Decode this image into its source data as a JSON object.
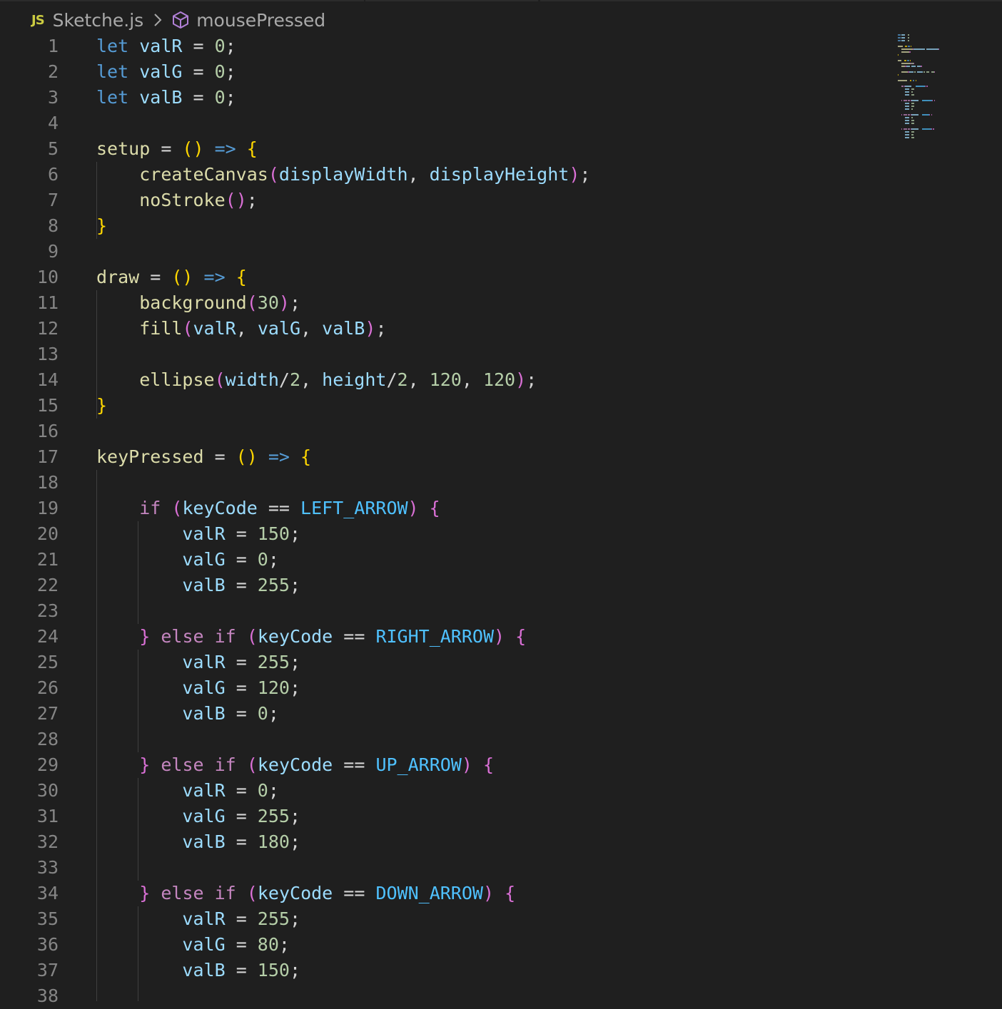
{
  "breadcrumb": {
    "file_badge": "JS",
    "file_name": "Sketche.js",
    "symbol_icon": "cube-icon",
    "symbol_name": "mousePressed"
  },
  "colors": {
    "background": "#1f1f1f",
    "keyword": "#569cd6",
    "control": "#c586c0",
    "variable": "#9cdcfe",
    "function": "#dcdcaa",
    "number": "#b5cea8",
    "constant": "#4fc1ff",
    "bracket_1": "#ffd700",
    "bracket_2": "#da70d6",
    "line_number": "#858585"
  },
  "lines": [
    {
      "n": "1",
      "tokens": [
        [
          "kw",
          "let"
        ],
        [
          "op",
          " "
        ],
        [
          "var",
          "valR"
        ],
        [
          "op",
          " = "
        ],
        [
          "num",
          "0"
        ],
        [
          "op",
          ";"
        ]
      ]
    },
    {
      "n": "2",
      "tokens": [
        [
          "kw",
          "let"
        ],
        [
          "op",
          " "
        ],
        [
          "var",
          "valG"
        ],
        [
          "op",
          " = "
        ],
        [
          "num",
          "0"
        ],
        [
          "op",
          ";"
        ]
      ]
    },
    {
      "n": "3",
      "tokens": [
        [
          "kw",
          "let"
        ],
        [
          "op",
          " "
        ],
        [
          "var",
          "valB"
        ],
        [
          "op",
          " = "
        ],
        [
          "num",
          "0"
        ],
        [
          "op",
          ";"
        ]
      ]
    },
    {
      "n": "4",
      "tokens": []
    },
    {
      "n": "5",
      "tokens": [
        [
          "fn",
          "setup"
        ],
        [
          "op",
          " = "
        ],
        [
          "p1",
          "()"
        ],
        [
          "op",
          " "
        ],
        [
          "kw",
          "=>"
        ],
        [
          "op",
          " "
        ],
        [
          "p1",
          "{"
        ]
      ]
    },
    {
      "n": "6",
      "tokens": [
        [
          "op",
          "    "
        ],
        [
          "fn",
          "createCanvas"
        ],
        [
          "p2",
          "("
        ],
        [
          "var",
          "displayWidth"
        ],
        [
          "op",
          ", "
        ],
        [
          "var",
          "displayHeight"
        ],
        [
          "p2",
          ")"
        ],
        [
          "op",
          ";"
        ]
      ]
    },
    {
      "n": "7",
      "tokens": [
        [
          "op",
          "    "
        ],
        [
          "fn",
          "noStroke"
        ],
        [
          "p2",
          "()"
        ],
        [
          "op",
          ";"
        ]
      ]
    },
    {
      "n": "8",
      "tokens": [
        [
          "p1",
          "}"
        ]
      ]
    },
    {
      "n": "9",
      "tokens": []
    },
    {
      "n": "10",
      "tokens": [
        [
          "fn",
          "draw"
        ],
        [
          "op",
          " = "
        ],
        [
          "p1",
          "()"
        ],
        [
          "op",
          " "
        ],
        [
          "kw",
          "=>"
        ],
        [
          "op",
          " "
        ],
        [
          "p1",
          "{"
        ]
      ]
    },
    {
      "n": "11",
      "tokens": [
        [
          "op",
          "    "
        ],
        [
          "fn",
          "background"
        ],
        [
          "p2",
          "("
        ],
        [
          "num",
          "30"
        ],
        [
          "p2",
          ")"
        ],
        [
          "op",
          ";"
        ]
      ]
    },
    {
      "n": "12",
      "tokens": [
        [
          "op",
          "    "
        ],
        [
          "fn",
          "fill"
        ],
        [
          "p2",
          "("
        ],
        [
          "var",
          "valR"
        ],
        [
          "op",
          ", "
        ],
        [
          "var",
          "valG"
        ],
        [
          "op",
          ", "
        ],
        [
          "var",
          "valB"
        ],
        [
          "p2",
          ")"
        ],
        [
          "op",
          ";"
        ]
      ]
    },
    {
      "n": "13",
      "tokens": []
    },
    {
      "n": "14",
      "tokens": [
        [
          "op",
          "    "
        ],
        [
          "fn",
          "ellipse"
        ],
        [
          "p2",
          "("
        ],
        [
          "var",
          "width"
        ],
        [
          "op",
          "/"
        ],
        [
          "num",
          "2"
        ],
        [
          "op",
          ", "
        ],
        [
          "var",
          "height"
        ],
        [
          "op",
          "/"
        ],
        [
          "num",
          "2"
        ],
        [
          "op",
          ", "
        ],
        [
          "num",
          "120"
        ],
        [
          "op",
          ", "
        ],
        [
          "num",
          "120"
        ],
        [
          "p2",
          ")"
        ],
        [
          "op",
          ";"
        ]
      ]
    },
    {
      "n": "15",
      "tokens": [
        [
          "p1",
          "}"
        ]
      ]
    },
    {
      "n": "16",
      "tokens": []
    },
    {
      "n": "17",
      "tokens": [
        [
          "fn",
          "keyPressed"
        ],
        [
          "op",
          " = "
        ],
        [
          "p1",
          "()"
        ],
        [
          "op",
          " "
        ],
        [
          "kw",
          "=>"
        ],
        [
          "op",
          " "
        ],
        [
          "p1",
          "{"
        ]
      ]
    },
    {
      "n": "18",
      "tokens": []
    },
    {
      "n": "19",
      "tokens": [
        [
          "op",
          "    "
        ],
        [
          "ctl",
          "if"
        ],
        [
          "op",
          " "
        ],
        [
          "p2",
          "("
        ],
        [
          "var",
          "keyCode"
        ],
        [
          "op",
          " == "
        ],
        [
          "const",
          "LEFT_ARROW"
        ],
        [
          "p2",
          ")"
        ],
        [
          "op",
          " "
        ],
        [
          "p2",
          "{"
        ]
      ]
    },
    {
      "n": "20",
      "tokens": [
        [
          "op",
          "        "
        ],
        [
          "var",
          "valR"
        ],
        [
          "op",
          " = "
        ],
        [
          "num",
          "150"
        ],
        [
          "op",
          ";"
        ]
      ]
    },
    {
      "n": "21",
      "tokens": [
        [
          "op",
          "        "
        ],
        [
          "var",
          "valG"
        ],
        [
          "op",
          " = "
        ],
        [
          "num",
          "0"
        ],
        [
          "op",
          ";"
        ]
      ]
    },
    {
      "n": "22",
      "tokens": [
        [
          "op",
          "        "
        ],
        [
          "var",
          "valB"
        ],
        [
          "op",
          " = "
        ],
        [
          "num",
          "255"
        ],
        [
          "op",
          ";"
        ]
      ]
    },
    {
      "n": "23",
      "tokens": []
    },
    {
      "n": "24",
      "tokens": [
        [
          "op",
          "    "
        ],
        [
          "p2",
          "}"
        ],
        [
          "op",
          " "
        ],
        [
          "ctl",
          "else"
        ],
        [
          "op",
          " "
        ],
        [
          "ctl",
          "if"
        ],
        [
          "op",
          " "
        ],
        [
          "p2",
          "("
        ],
        [
          "var",
          "keyCode"
        ],
        [
          "op",
          " == "
        ],
        [
          "const",
          "RIGHT_ARROW"
        ],
        [
          "p2",
          ")"
        ],
        [
          "op",
          " "
        ],
        [
          "p2",
          "{"
        ]
      ]
    },
    {
      "n": "25",
      "tokens": [
        [
          "op",
          "        "
        ],
        [
          "var",
          "valR"
        ],
        [
          "op",
          " = "
        ],
        [
          "num",
          "255"
        ],
        [
          "op",
          ";"
        ]
      ]
    },
    {
      "n": "26",
      "tokens": [
        [
          "op",
          "        "
        ],
        [
          "var",
          "valG"
        ],
        [
          "op",
          " = "
        ],
        [
          "num",
          "120"
        ],
        [
          "op",
          ";"
        ]
      ]
    },
    {
      "n": "27",
      "tokens": [
        [
          "op",
          "        "
        ],
        [
          "var",
          "valB"
        ],
        [
          "op",
          " = "
        ],
        [
          "num",
          "0"
        ],
        [
          "op",
          ";"
        ]
      ]
    },
    {
      "n": "28",
      "tokens": []
    },
    {
      "n": "29",
      "tokens": [
        [
          "op",
          "    "
        ],
        [
          "p2",
          "}"
        ],
        [
          "op",
          " "
        ],
        [
          "ctl",
          "else"
        ],
        [
          "op",
          " "
        ],
        [
          "ctl",
          "if"
        ],
        [
          "op",
          " "
        ],
        [
          "p2",
          "("
        ],
        [
          "var",
          "keyCode"
        ],
        [
          "op",
          " == "
        ],
        [
          "const",
          "UP_ARROW"
        ],
        [
          "p2",
          ")"
        ],
        [
          "op",
          " "
        ],
        [
          "p2",
          "{"
        ]
      ]
    },
    {
      "n": "30",
      "tokens": [
        [
          "op",
          "        "
        ],
        [
          "var",
          "valR"
        ],
        [
          "op",
          " = "
        ],
        [
          "num",
          "0"
        ],
        [
          "op",
          ";"
        ]
      ]
    },
    {
      "n": "31",
      "tokens": [
        [
          "op",
          "        "
        ],
        [
          "var",
          "valG"
        ],
        [
          "op",
          " = "
        ],
        [
          "num",
          "255"
        ],
        [
          "op",
          ";"
        ]
      ]
    },
    {
      "n": "32",
      "tokens": [
        [
          "op",
          "        "
        ],
        [
          "var",
          "valB"
        ],
        [
          "op",
          " = "
        ],
        [
          "num",
          "180"
        ],
        [
          "op",
          ";"
        ]
      ]
    },
    {
      "n": "33",
      "tokens": []
    },
    {
      "n": "34",
      "tokens": [
        [
          "op",
          "    "
        ],
        [
          "p2",
          "}"
        ],
        [
          "op",
          " "
        ],
        [
          "ctl",
          "else"
        ],
        [
          "op",
          " "
        ],
        [
          "ctl",
          "if"
        ],
        [
          "op",
          " "
        ],
        [
          "p2",
          "("
        ],
        [
          "var",
          "keyCode"
        ],
        [
          "op",
          " == "
        ],
        [
          "const",
          "DOWN_ARROW"
        ],
        [
          "p2",
          ")"
        ],
        [
          "op",
          " "
        ],
        [
          "p2",
          "{"
        ]
      ]
    },
    {
      "n": "35",
      "tokens": [
        [
          "op",
          "        "
        ],
        [
          "var",
          "valR"
        ],
        [
          "op",
          " = "
        ],
        [
          "num",
          "255"
        ],
        [
          "op",
          ";"
        ]
      ]
    },
    {
      "n": "36",
      "tokens": [
        [
          "op",
          "        "
        ],
        [
          "var",
          "valG"
        ],
        [
          "op",
          " = "
        ],
        [
          "num",
          "80"
        ],
        [
          "op",
          ";"
        ]
      ]
    },
    {
      "n": "37",
      "tokens": [
        [
          "op",
          "        "
        ],
        [
          "var",
          "valB"
        ],
        [
          "op",
          " = "
        ],
        [
          "num",
          "150"
        ],
        [
          "op",
          ";"
        ]
      ]
    },
    {
      "n": "38",
      "tokens": []
    }
  ]
}
